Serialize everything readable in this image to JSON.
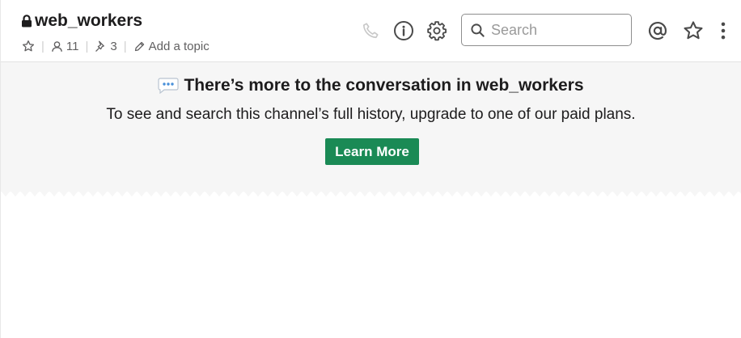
{
  "channel": {
    "name": "web_workers",
    "lock_icon": "lock-icon",
    "member_count": "11",
    "pinned_count": "3",
    "add_topic_label": "Add a topic"
  },
  "toolbar": {
    "icons": [
      "phone-icon",
      "info-icon",
      "gear-icon",
      "at-sign-icon",
      "star-icon",
      "more-vertical-icon"
    ],
    "search_placeholder": "Search"
  },
  "upsell": {
    "title": "There’s more to the conversation in web_workers",
    "subtitle": "To see and search this channel’s full history, upgrade to one of our paid plans.",
    "button_label": "Learn More",
    "icon": "speech-bubble-icon"
  },
  "colors": {
    "button_green": "#1a8a55",
    "banner_bg": "#f6f6f6",
    "speech_bubble_blue": "#4a90d9"
  }
}
